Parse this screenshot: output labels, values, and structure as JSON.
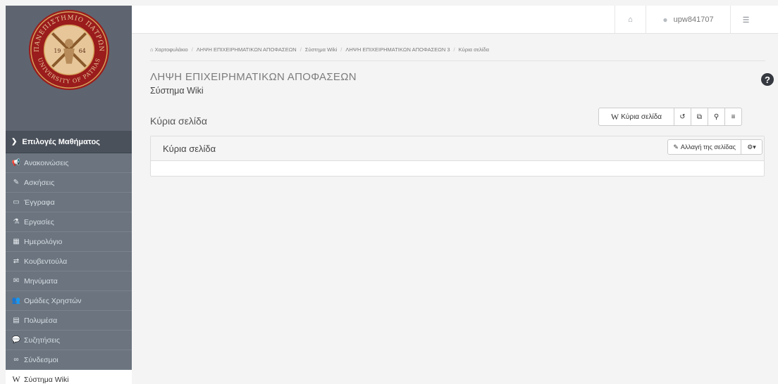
{
  "topbar": {
    "home_icon": "home-icon",
    "user_icon": "user-icon",
    "username": "upw841707",
    "settings_icon": "sliders-icon"
  },
  "sidebar": {
    "logo": {
      "top_text": "ΠΑΝΕΠΙΣΤΗΜΙΟ ΠΑΤΡΩΝ",
      "bottom_text": "UNIVERSITY OF PATRAS",
      "year_left": "19",
      "year_right": "64"
    },
    "course_options_label": "Επιλογές Μαθήματος",
    "items": [
      {
        "icon": "megaphone-icon",
        "glyph": "📢",
        "label": "Ανακοινώσεις"
      },
      {
        "icon": "edit-icon",
        "glyph": "✎",
        "label": "Ασκήσεις"
      },
      {
        "icon": "folder-icon",
        "glyph": "▭",
        "label": "Έγγραφα"
      },
      {
        "icon": "flask-icon",
        "glyph": "⚗",
        "label": "Εργασίες"
      },
      {
        "icon": "calendar-icon",
        "glyph": "▦",
        "label": "Ημερολόγιο"
      },
      {
        "icon": "exchange-icon",
        "glyph": "⇄",
        "label": "Κουβεντούλα"
      },
      {
        "icon": "envelope-icon",
        "glyph": "✉",
        "label": "Μηνύματα"
      },
      {
        "icon": "users-icon",
        "glyph": "👥",
        "label": "Ομάδες Χρηστών"
      },
      {
        "icon": "film-icon",
        "glyph": "▤",
        "label": "Πολυμέσα"
      },
      {
        "icon": "comments-icon",
        "glyph": "💬",
        "label": "Συζητήσεις"
      },
      {
        "icon": "link-icon",
        "glyph": "∞",
        "label": "Σύνδεσμοι"
      },
      {
        "icon": "wikipedia-icon",
        "glyph": "W",
        "label": "Σύστημα Wiki",
        "active": true
      }
    ]
  },
  "breadcrumb": {
    "home_icon": "home-icon",
    "items": [
      "Χαρτοφυλάκιο",
      "ΛΗΨΗ ΕΠΙΧΕΙΡΗΜΑΤΙΚΩΝ ΑΠΟΦΑΣΕΩΝ",
      "Σύστημα Wiki",
      "ΛΗΨΗ ΕΠΙΧΕΙΡΗΜΑΤΙΚΩΝ ΑΠΟΦΑΣΕΩΝ 3",
      "Κύρια σελίδα"
    ]
  },
  "header": {
    "course_title": "ΛΗΨΗ ΕΠΙΧΕΙΡΗΜΑΤΙΚΩΝ ΑΠΟΦΑΣΕΩΝ",
    "module_title": "Σύστημα Wiki",
    "help_icon": "question-circle-icon",
    "help_glyph": "?",
    "page_heading": "Κύρια σελίδα"
  },
  "toolbar": {
    "main_page_label": "Κύρια σελίδα",
    "wiki_glyph": "W",
    "history_icon": "history-icon",
    "history_glyph": "↺",
    "recent_icon": "pages-icon",
    "recent_glyph": "⧉",
    "search_icon": "search-icon",
    "search_glyph": "🔍",
    "list_icon": "list-icon",
    "list_glyph": "≡"
  },
  "panel": {
    "title": "Κύρια σελίδα",
    "edit_label": "Αλλαγή της σελίδας",
    "edit_glyph": "✎",
    "gear_glyph": "⚙▾"
  },
  "colors": {
    "sidebar_bg": "#6b747f",
    "sidebar_header_bg": "#4a515b",
    "logo_red": "#9b1c1c",
    "logo_gold": "#d6a25a"
  }
}
